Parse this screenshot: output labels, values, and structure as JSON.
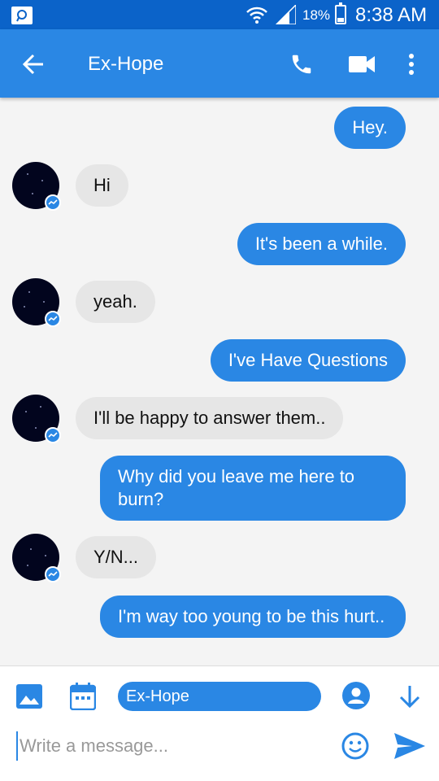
{
  "status_bar": {
    "battery_percent": "18%",
    "time": "8:38 AM",
    "icons": [
      "app-notification-icon",
      "wifi-icon",
      "signal-icon",
      "battery-icon"
    ]
  },
  "header": {
    "title": "Ex-Hope",
    "icons": [
      "back-arrow-icon",
      "phone-call-icon",
      "video-call-icon",
      "more-vert-icon"
    ]
  },
  "messages": [
    {
      "from": "me",
      "text": "Hey."
    },
    {
      "from": "them",
      "text": "Hi"
    },
    {
      "from": "me",
      "text": "It's been a while."
    },
    {
      "from": "them",
      "text": "yeah."
    },
    {
      "from": "me",
      "text": "I've Have Questions"
    },
    {
      "from": "them",
      "text": "I'll be happy to answer them.."
    },
    {
      "from": "me",
      "text": "Why did you leave me here to burn?"
    },
    {
      "from": "them",
      "text": "Y/N..."
    },
    {
      "from": "me",
      "text": "I'm way too young to be this hurt.."
    }
  ],
  "composer": {
    "recipient": "Ex-Hope",
    "placeholder": "Write a message...",
    "icons": [
      "gallery-icon",
      "calendar-icon",
      "person-icon",
      "down-arrow-icon",
      "emoji-icon",
      "send-icon"
    ]
  },
  "colors": {
    "status_bar": "#0b63c9",
    "app_bar": "#2a87e4",
    "outgoing_bubble": "#2a87e4",
    "incoming_bubble": "#e6e6e6",
    "background": "#f4f4f4"
  }
}
